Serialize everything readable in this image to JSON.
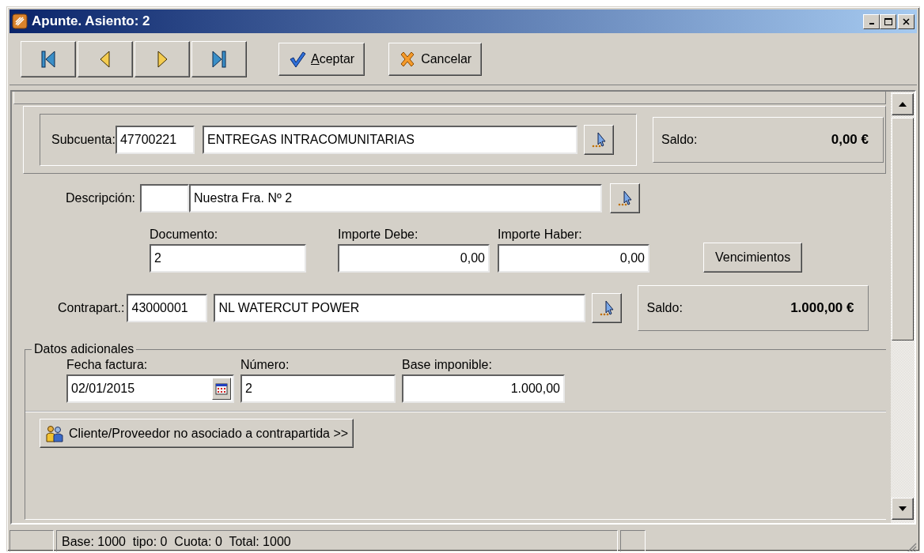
{
  "window": {
    "title": "Apunte. Asiento: 2"
  },
  "toolbar": {
    "nav_buttons": [
      {
        "kind": "first"
      },
      {
        "kind": "prev"
      },
      {
        "kind": "next"
      },
      {
        "kind": "last"
      }
    ],
    "buttons": [
      {
        "kind": "accept",
        "label": "Aceptar",
        "underline_first": true
      },
      {
        "kind": "cancel",
        "label": "Cancelar",
        "underline_first": false
      }
    ]
  },
  "subcuenta": {
    "label": "Subcuenta:",
    "code": "47700221",
    "name": "ENTREGAS INTRACOMUNITARIAS",
    "saldo_label": "Saldo:",
    "saldo": "0,00 €"
  },
  "descripcion": {
    "label": "Descripción:",
    "text": "Nuestra Fra. Nº 2"
  },
  "importes": [
    {
      "label": "Documento:",
      "value": "2"
    },
    {
      "label": "Importe Debe:",
      "value": "0,00"
    },
    {
      "label": "Importe Haber:",
      "value": "0,00"
    }
  ],
  "vencimientos_button": "Vencimientos",
  "contrapartida": {
    "label": "Contrapart.:",
    "code": "43000001",
    "name": "NL WATERCUT POWER",
    "saldo_label": "Saldo:",
    "saldo": "1.000,00 €"
  },
  "datos_adicionales": {
    "title": "Datos adicionales",
    "fields": [
      {
        "kind": "date",
        "label": "Fecha factura:",
        "value": "02/01/2015"
      },
      {
        "kind": "text",
        "label": "Número:",
        "value": "2"
      },
      {
        "kind": "number",
        "label": "Base imponible:",
        "value": "1.000,00"
      }
    ],
    "client_button": "Cliente/Proveedor no asociado a contrapartida >>"
  },
  "status_bar": {
    "text": "Base: 1000  tipo: 0  Cuota: 0  Total: 1000"
  }
}
